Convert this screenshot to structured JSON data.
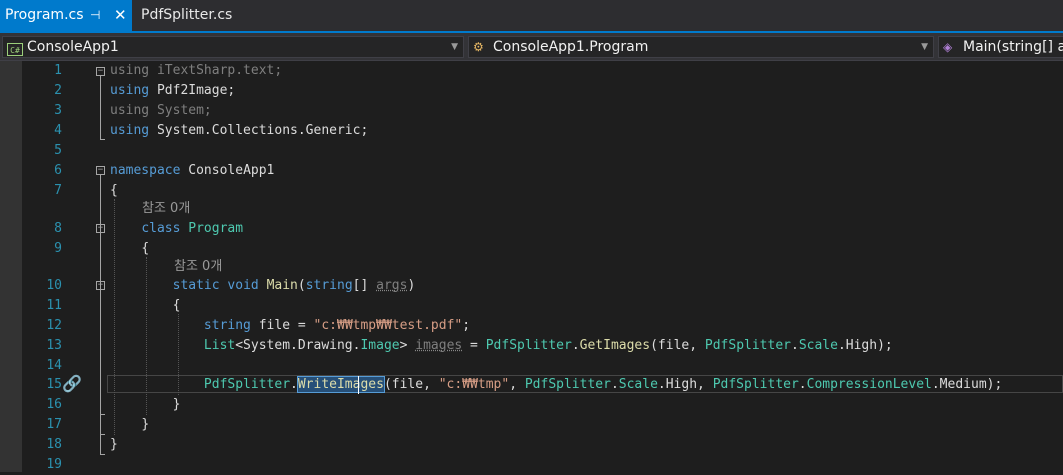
{
  "tabs": {
    "active_label": "Program.cs",
    "inactive_label": "PdfSplitter.cs"
  },
  "nav": {
    "project": "ConsoleApp1",
    "type": "ConsoleApp1.Program",
    "member": "Main(string[] a"
  },
  "codelens": {
    "class_refs": "참조 0개",
    "main_refs": "참조 0개"
  },
  "line_numbers": [
    "1",
    "2",
    "3",
    "4",
    "5",
    "6",
    "7",
    "8",
    "9",
    "10",
    "11",
    "12",
    "13",
    "14",
    "15",
    "16",
    "17",
    "18",
    "19"
  ],
  "code": {
    "l1": {
      "kw": "using",
      "rest": " iTextSharp.text;"
    },
    "l2": {
      "kw": "using",
      "rest": " Pdf2Image;"
    },
    "l3": {
      "kw": "using",
      "rest": " System;"
    },
    "l4": {
      "kw": "using",
      "rest": " System.Collections.Generic;"
    },
    "l6": {
      "kw": "namespace",
      "rest": " ConsoleApp1"
    },
    "l7": "{",
    "l8": {
      "kw": "class",
      "type": "Program"
    },
    "l9": "{",
    "l10": {
      "kw1": "static",
      "kw2": "void",
      "method": "Main",
      "open": "(",
      "kw3": "string",
      "mid": "[] ",
      "param": "args",
      "close": ")"
    },
    "l11": "{",
    "l12": {
      "kw": "string",
      "mid": " file = ",
      "str": "\"c:₩₩tmp₩₩test.pdf\"",
      "end": ";"
    },
    "l13": {
      "type1": "List",
      "a": "<System.Drawing.",
      "type2": "Image",
      "b": "> ",
      "var": "images",
      "c": " = ",
      "type3": "PdfSplitter",
      "d": ".",
      "method": "GetImages",
      "e": "(file, ",
      "type4": "PdfSplitter",
      "f": ".",
      "type5": "Scale",
      "g": ".High);"
    },
    "l15": {
      "type1": "PdfSplitter",
      "a": ".",
      "method_sel": "WriteImages",
      "b": "(file, ",
      "str": "\"c:₩₩tmp\"",
      "c": ", ",
      "type2": "PdfSplitter",
      "d": ".",
      "type3": "Scale",
      "e": ".High, ",
      "type4": "PdfSplitter",
      "f": ".",
      "type5": "CompressionLevel",
      "g": ".Medium);"
    },
    "l16": "}",
    "l17": "}",
    "l18": "}"
  },
  "colors": {
    "keyword": "#569cd6",
    "type": "#4ec9b0",
    "string": "#d69d85",
    "method": "#dcdcaa",
    "line_number": "#2b91af",
    "accent": "#007acc"
  }
}
